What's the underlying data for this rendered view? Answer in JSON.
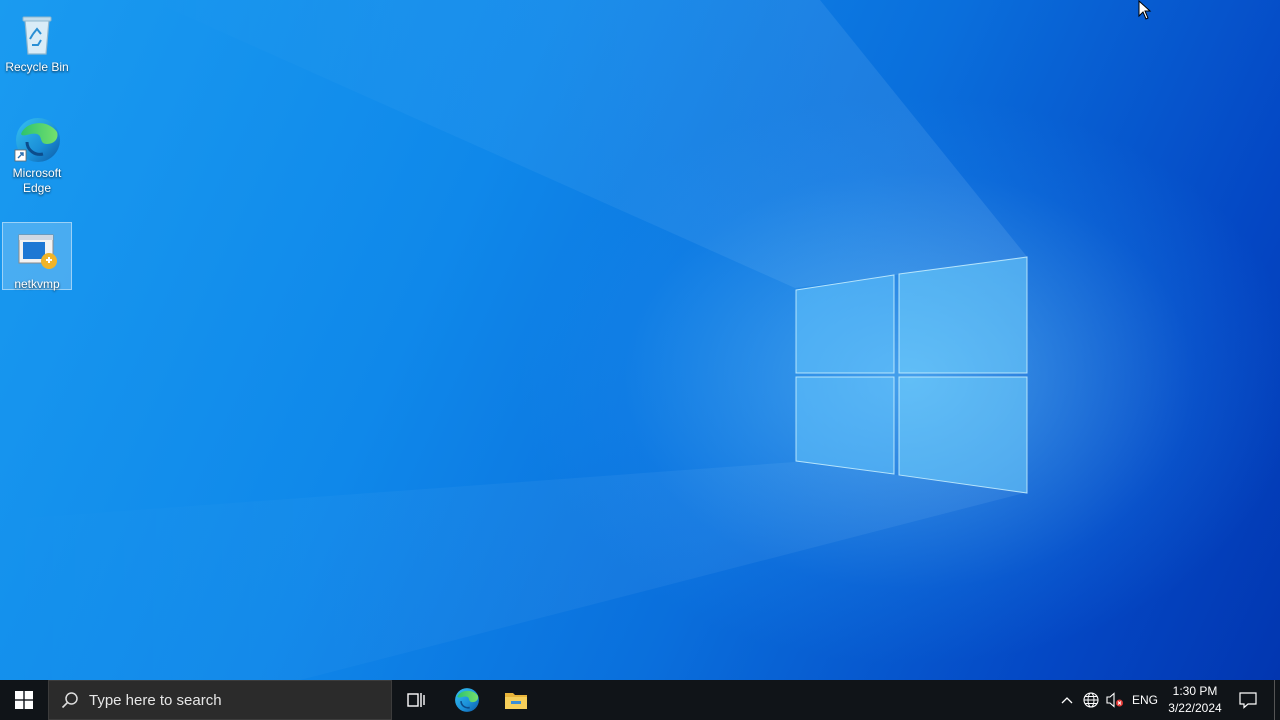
{
  "desktop": {
    "icons": [
      {
        "label": "Recycle Bin",
        "icon": "recycle-bin-icon"
      },
      {
        "label": "Microsoft Edge",
        "icon": "edge-icon"
      },
      {
        "label": "netkvmp",
        "icon": "installer-icon",
        "selected": true
      }
    ]
  },
  "taskbar": {
    "start_icon": "windows-start-icon",
    "search_placeholder": "Type here to search",
    "pinned": [
      "task-view-icon",
      "edge-icon",
      "file-explorer-icon"
    ],
    "tray": {
      "language": "ENG",
      "time": "1:30 PM",
      "date": "3/22/2024"
    }
  },
  "colors": {
    "taskbar": "#101418",
    "search_box": "#2b2b2b",
    "wallpaper_accent": "#0a6fdc"
  }
}
